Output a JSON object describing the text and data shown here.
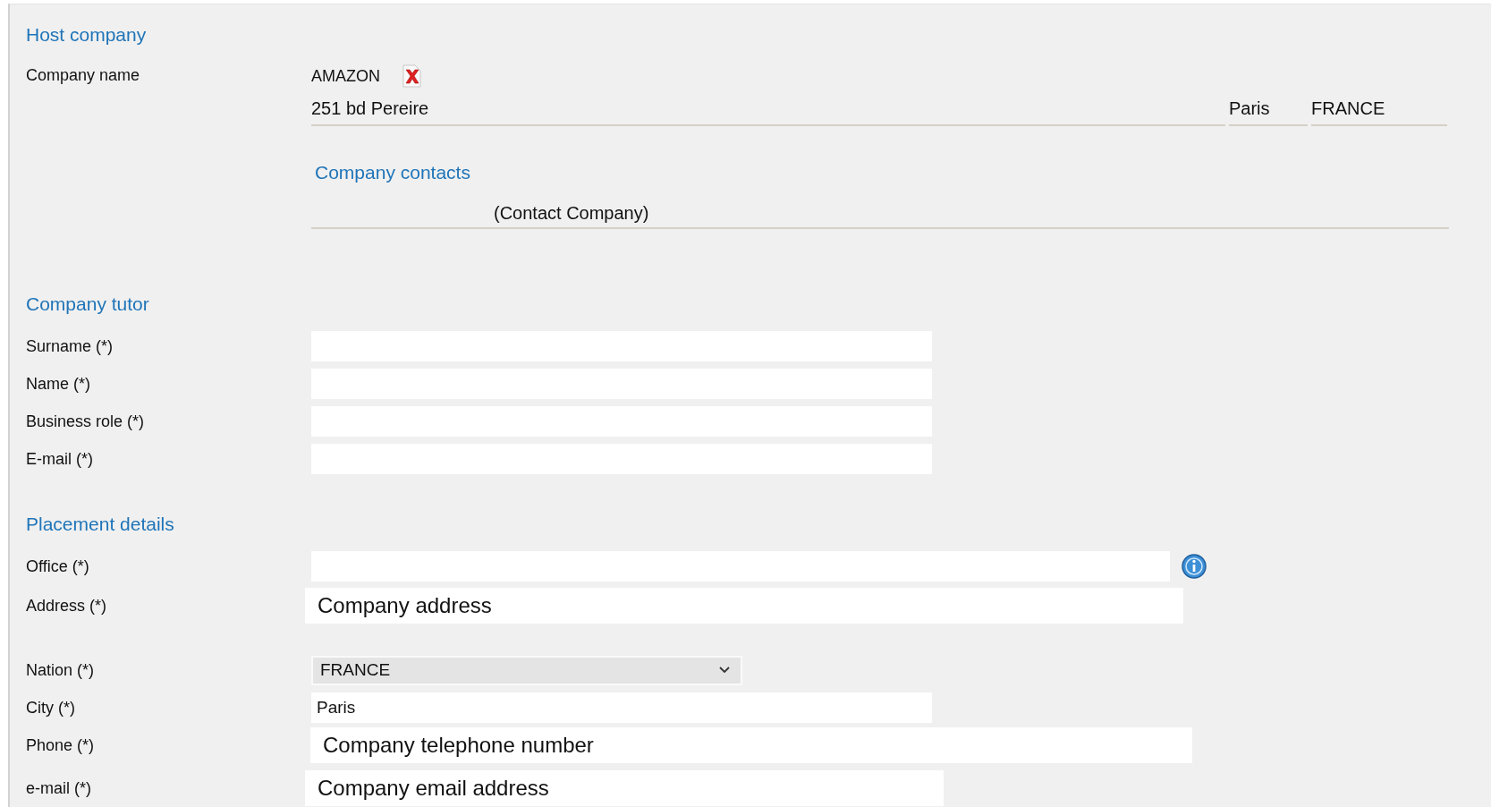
{
  "host_company": {
    "heading": "Host company",
    "name_label": "Company name",
    "name": "AMAZON",
    "street": "251 bd Pereire",
    "city": "Paris",
    "country": "FRANCE",
    "contacts": {
      "heading": "Company contacts",
      "rows": [
        {
          "text": "(Contact Company)"
        }
      ]
    }
  },
  "company_tutor": {
    "heading": "Company tutor",
    "fields": [
      {
        "label": "Surname (*)",
        "kind": "input"
      },
      {
        "label": "Name (*)",
        "kind": "input"
      },
      {
        "label": "Business role (*)",
        "kind": "input"
      },
      {
        "label": "E-mail (*)",
        "kind": "input"
      }
    ]
  },
  "placement_details": {
    "heading": "Placement details",
    "fields": [
      {
        "label": "Office (*)",
        "kind": "input",
        "info": true
      },
      {
        "label": "Address (*)",
        "kind": "note",
        "value": "Company address"
      },
      {
        "label": "Nation (*)",
        "kind": "select",
        "value": "FRANCE"
      },
      {
        "label": "City (*)",
        "kind": "input",
        "value": "Paris"
      },
      {
        "label": "Phone (*)",
        "kind": "note",
        "value": "Company telephone number"
      },
      {
        "label": "e-mail (*)",
        "kind": "note",
        "value": "Company email address"
      }
    ]
  }
}
